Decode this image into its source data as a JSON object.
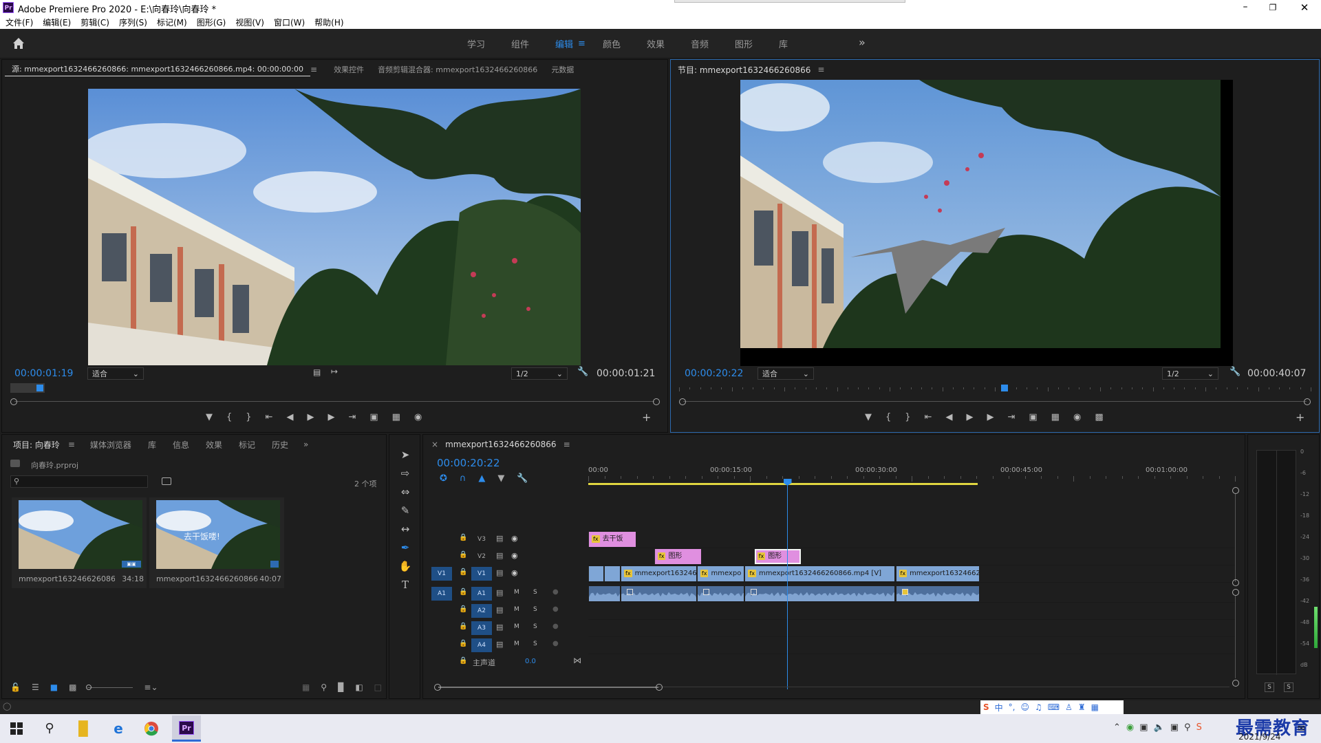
{
  "app": {
    "title": "Adobe Premiere Pro 2020 - E:\\向春玲\\向春玲 *",
    "logo": "Pr"
  },
  "menu": [
    "文件(F)",
    "编辑(E)",
    "剪辑(C)",
    "序列(S)",
    "标记(M)",
    "图形(G)",
    "视图(V)",
    "窗口(W)",
    "帮助(H)"
  ],
  "workspaces": [
    "学习",
    "组件",
    "编辑",
    "颜色",
    "效果",
    "音频",
    "图形",
    "库"
  ],
  "workspace_active_index": 2,
  "workspace_more": "»",
  "source": {
    "tabs": [
      "源: mmexport1632466260866: mmexport1632466260866.mp4: 00:00:00:00",
      "效果控件",
      "音频剪辑混合器: mmexport1632466260866",
      "元数据"
    ],
    "tc_current": "00:00:01:19",
    "fit": "适合",
    "res": "1/2",
    "tc_duration": "00:00:01:21",
    "playhead_fraction": 0.04
  },
  "program": {
    "tab": "节目: mmexport1632466260866",
    "tc_current": "00:00:20:22",
    "fit": "适合",
    "res": "1/2",
    "tc_duration": "00:00:40:07",
    "playhead_fraction": 0.51
  },
  "project": {
    "tabs": [
      "项目: 向春玲",
      "媒体浏览器",
      "库",
      "信息",
      "效果",
      "标记",
      "历史"
    ],
    "file": "向春玲.prproj",
    "item_count": "2 个项",
    "items": [
      {
        "name": "mmexport1632466260866....",
        "duration": "34:18"
      },
      {
        "name": "mmexport1632466260866",
        "duration": "40:07",
        "overlay": "去干饭喽!"
      }
    ]
  },
  "timeline": {
    "tab": "mmexport1632466260866",
    "tc": "00:00:20:22",
    "ruler": [
      "00:00",
      "00:00:15:00",
      "00:00:30:00",
      "00:00:45:00",
      "00:01:00:00"
    ],
    "playhead_fraction": 0.308,
    "video_tracks": [
      {
        "label": "V3",
        "clips": [
          {
            "name": "去干饭",
            "start": 0.0,
            "end": 0.074,
            "kind": "pink"
          }
        ]
      },
      {
        "label": "V2",
        "clips": [
          {
            "name": "图形",
            "start": 0.102,
            "end": 0.176,
            "kind": "pink"
          },
          {
            "name": "图形",
            "start": 0.256,
            "end": 0.33,
            "kind": "pink-sel"
          }
        ]
      },
      {
        "label": "V1",
        "src": "V1",
        "clips": [
          {
            "name": "",
            "start": 0.0,
            "end": 0.024,
            "kind": "blue"
          },
          {
            "name": "",
            "start": 0.024,
            "end": 0.05,
            "kind": "blue"
          },
          {
            "name": "mmexport1632466",
            "start": 0.05,
            "end": 0.168,
            "kind": "blue"
          },
          {
            "name": "mmexpo",
            "start": 0.168,
            "end": 0.242,
            "kind": "blue"
          },
          {
            "name": "mmexport1632466260866.mp4 [V]",
            "start": 0.242,
            "end": 0.475,
            "kind": "blue"
          },
          {
            "name": "mmexport163246626",
            "start": 0.475,
            "end": 0.605,
            "kind": "blue"
          }
        ]
      }
    ],
    "audio_tracks": [
      {
        "label": "A1",
        "src": "A1",
        "m": "M",
        "s": "S"
      },
      {
        "label": "A2",
        "m": "M",
        "s": "S"
      },
      {
        "label": "A3",
        "m": "M",
        "s": "S"
      },
      {
        "label": "A4",
        "m": "M",
        "s": "S"
      }
    ],
    "master": {
      "label": "主声道",
      "value": "0.0"
    }
  },
  "meter": {
    "scale": [
      "0",
      "-6",
      "-12",
      "-18",
      "-24",
      "-30",
      "-36",
      "-42",
      "-48",
      "-54",
      "dB"
    ],
    "solo": [
      "S",
      "S"
    ],
    "level_fraction": 0.18
  },
  "taskbar": {
    "date": "2021/9/24",
    "watermark": "最需教育",
    "ime": "中"
  },
  "colors": {
    "accent": "#2d8ceb",
    "pink_clip": "#e08fe0",
    "blue_clip": "#7fa6d6",
    "audio_clip": "#4e6f9c"
  }
}
